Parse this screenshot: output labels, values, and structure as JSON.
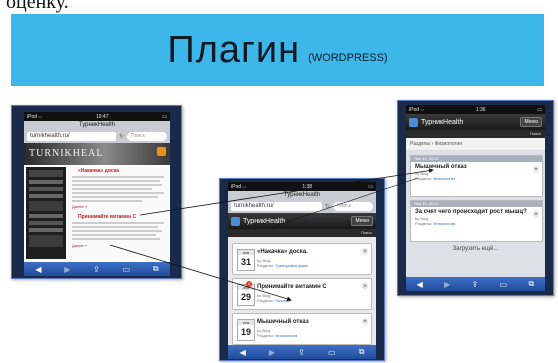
{
  "top_text": "оценку.",
  "banner": {
    "title": "Плагин",
    "subtitle": "(WORDPRESS)",
    "color": "#3db7ea"
  },
  "phone_left": {
    "status_left": "iPod ⌵",
    "time": "19:47",
    "site_title": "ТурникHealth",
    "url": "turnikhealth.ru/",
    "search_placeholder": "Поиск",
    "header_logo": "TURNIKHEAL",
    "post1_title": "«Накачка» доска",
    "post2_title": "Принимайте витамин С",
    "more1": "Далее »",
    "more2": "Далее »"
  },
  "phone_mid": {
    "status_left": "iPod ⌵",
    "time": "1:38",
    "site_title": "ТурникHealth",
    "url": "turnikhealth.ru/",
    "search_placeholder": "Поиск",
    "app_name": "ТурникHealth",
    "menu_label": "Меню",
    "search_link": "Поиск",
    "cards": [
      {
        "month": "янв",
        "day": "31",
        "title": "«Накачка» доска.",
        "meta": "by Blog",
        "category_prefix": "Разделы:",
        "category": "Тренировки дома"
      },
      {
        "month": "янв",
        "day": "29",
        "title": "Принимайте витамин С",
        "meta": "by Blog",
        "category_prefix": "Разделы:",
        "category": "Питание",
        "badge": "1"
      },
      {
        "month": "янв",
        "day": "19",
        "title": "Мышечный отказ",
        "meta": "by Blog",
        "category_prefix": "Разделы:",
        "category": "Физиология"
      }
    ]
  },
  "phone_right": {
    "status_left": "iPod ⌵",
    "time": "1:36",
    "app_name": "ТурникHealth",
    "menu_label": "Меню",
    "search_link": "Поиск",
    "section": "Разделы › Физиология",
    "date1": "Янв 19, 2013",
    "post1_title": "Мышечный отказ",
    "post1_meta": "by Blog",
    "post1_cat_prefix": "Разделы:",
    "post1_cat": "Физиология",
    "date2": "Янв 11, 2013",
    "post2_title": "За счет чего происходит рост мышц?",
    "post2_meta": "by Blog",
    "post2_cat_prefix": "Разделы:",
    "post2_cat": "Физиология",
    "load_more": "Загрузить ещё..."
  },
  "toolbar_icons": [
    "back-icon",
    "forward-icon",
    "share-icon",
    "bookmarks-icon",
    "tabs-icon"
  ]
}
